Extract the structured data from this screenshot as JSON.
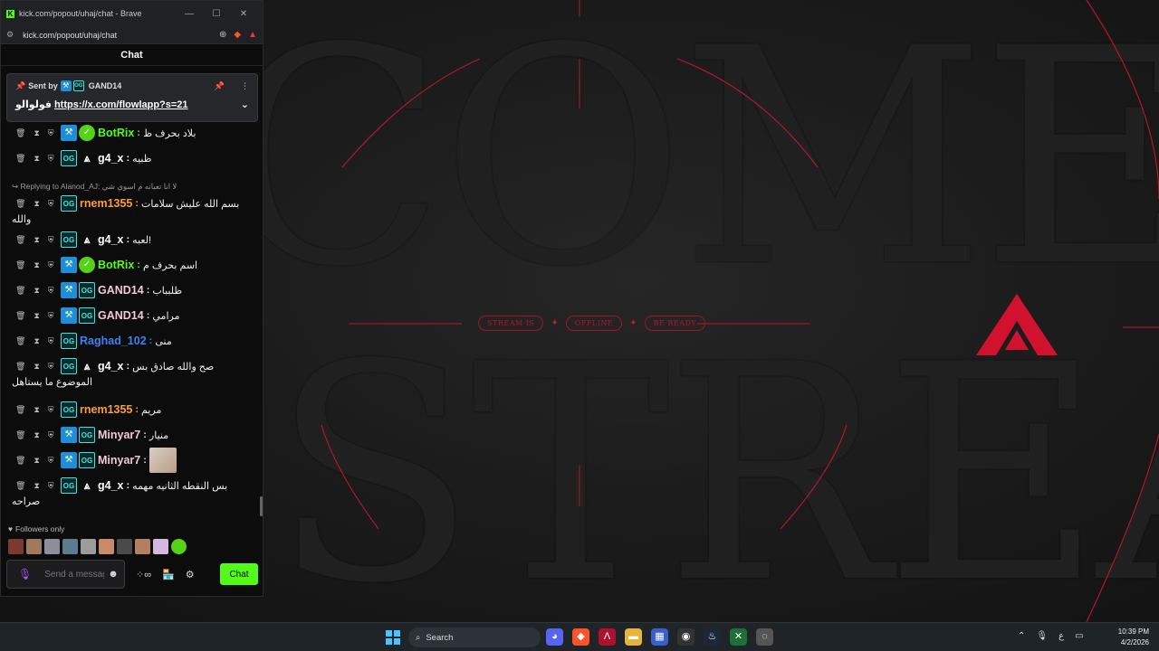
{
  "window": {
    "title": "kick.com/popout/uhaj/chat - Brave",
    "url": "kick.com/popout/uhaj/chat"
  },
  "chat": {
    "header": "Chat",
    "pinned": {
      "sent_by_label": "Sent by",
      "sender": "GAND14",
      "text": "فولوالو",
      "link": "https://x.com/flowlapp?s=21"
    },
    "messages": [
      {
        "user": "BotRix",
        "color": "#53fc18",
        "badges": [
          "mod",
          "verified"
        ],
        "text": "بلاد بحرف ظ"
      },
      {
        "user": "g4_x",
        "color": "#ffffff",
        "badges": [
          "og",
          "crown"
        ],
        "text": "ظبيه"
      },
      {
        "user": "rnem1355",
        "color": "#ff9d2e",
        "badges": [
          "og"
        ],
        "text": "بسم الله عليش سلامات",
        "cont": "والله",
        "reply_label": "Replying to Alanod_AJ:",
        "reply_text": "لا انا تعبانه م اسوي شي"
      },
      {
        "user": "g4_x",
        "color": "#ffffff",
        "badges": [
          "og",
          "crown"
        ],
        "text": "لعبه!"
      },
      {
        "user": "BotRix",
        "color": "#53fc18",
        "badges": [
          "mod",
          "verified"
        ],
        "text": "اسم بحرف م"
      },
      {
        "user": "GAND14",
        "color": "#f0c8d8",
        "badges": [
          "mod",
          "og"
        ],
        "text": "ظلبباب"
      },
      {
        "user": "GAND14",
        "color": "#f0c8d8",
        "badges": [
          "mod",
          "og"
        ],
        "text": "مرامي"
      },
      {
        "user": "Raghad_102",
        "color": "#3b82f6",
        "badges": [
          "og"
        ],
        "text": "منى"
      },
      {
        "user": "g4_x",
        "color": "#ffffff",
        "badges": [
          "og",
          "crown"
        ],
        "text": "صح والله صادق بس",
        "cont": "الموضوع ما يستاهل"
      },
      {
        "user": "rnem1355",
        "color": "#ff9d2e",
        "badges": [
          "og"
        ],
        "text": "مريم"
      },
      {
        "user": "Minyar7",
        "color": "#f0c8d8",
        "badges": [
          "mod",
          "og"
        ],
        "text": "منيار"
      },
      {
        "user": "Minyar7",
        "color": "#f0c8d8",
        "badges": [
          "mod",
          "og"
        ],
        "text": "",
        "image": true
      },
      {
        "user": "g4_x",
        "color": "#ffffff",
        "badges": [
          "og",
          "crown"
        ],
        "text": "بس النقطه الثانيه مهمه",
        "cont": "صراحه"
      }
    ],
    "followers_only": "Followers only",
    "input_placeholder": "Send a message",
    "chat_button": "Chat"
  },
  "wallpaper": {
    "word1": "COME",
    "word2": "STREA",
    "pills": [
      "STREAM IS",
      "OFFLINE",
      "BE READY"
    ],
    "accent": "#c4182f"
  },
  "taskbar": {
    "search_label": "Search",
    "time": "10:39 PM",
    "date": "4/2/2026",
    "lang": "ع"
  }
}
